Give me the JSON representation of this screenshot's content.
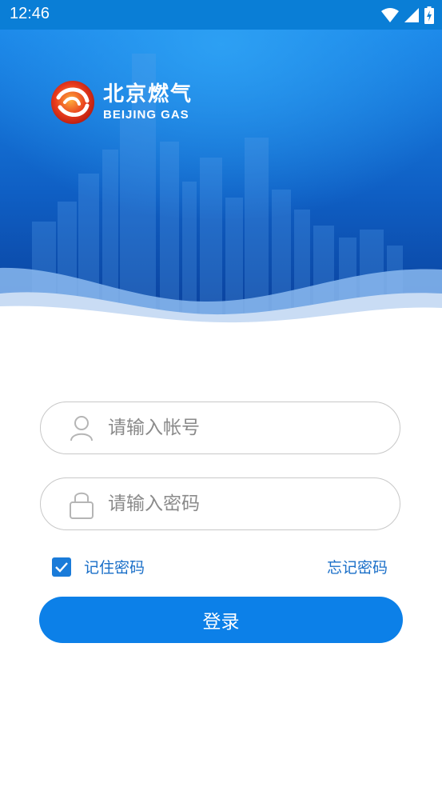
{
  "status_bar": {
    "time": "12:46"
  },
  "brand": {
    "name_cn": "北京燃气",
    "name_en": "BEIJING GAS"
  },
  "form": {
    "account": {
      "placeholder": "请输入帐号",
      "value": ""
    },
    "password": {
      "placeholder": "请输入密码",
      "value": ""
    },
    "remember_label": "记住密码",
    "remember_checked": true,
    "forgot_label": "忘记密码",
    "login_label": "登录"
  },
  "colors": {
    "status_bar": "#0a7ed6",
    "primary": "#0c80e8",
    "link": "#1a6fc8",
    "hero_dark": "#0a3f9a",
    "hero_light": "#1a86e8"
  },
  "icons": [
    "wifi-icon",
    "signal-icon",
    "battery-icon",
    "logo-icon",
    "user-icon",
    "lock-icon",
    "check-icon"
  ]
}
